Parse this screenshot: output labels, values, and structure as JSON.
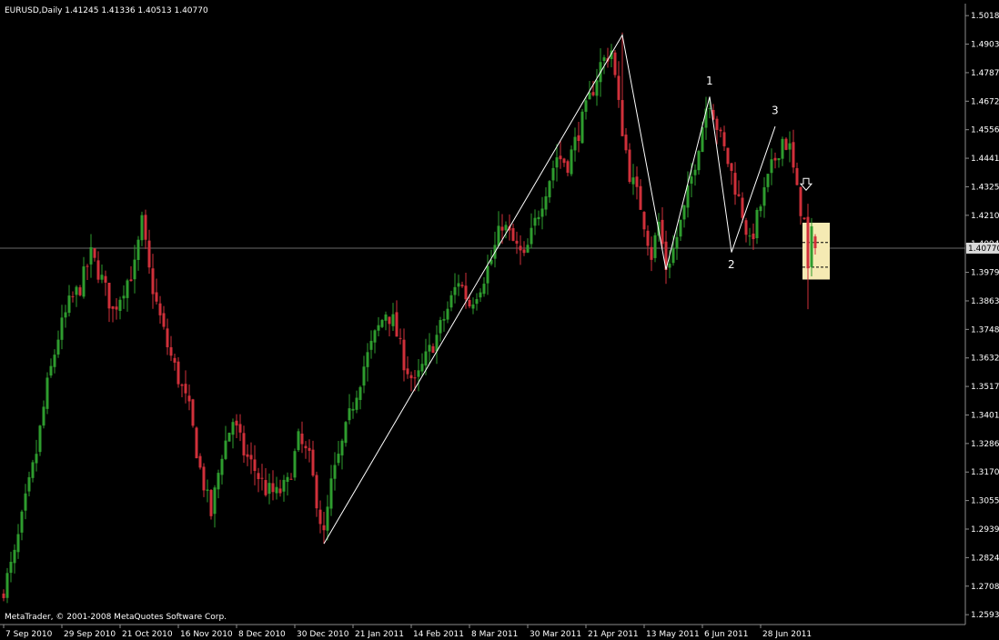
{
  "window": {
    "symbol_header": "EURUSD,Daily  1.41245 1.41336 1.40513 1.40770",
    "copyright": "MetaTrader, © 2001-2008 MetaQuotes Software Corp."
  },
  "colors": {
    "background": "#000000",
    "bull": "#2e9c2e",
    "bear": "#d0303a",
    "axis": "#8c8c8c",
    "zigzag": "#ffffff",
    "highlight_box": "#f5eab3"
  },
  "icons": {
    "signal_arrow": "down-arrow-icon"
  },
  "chart_data": {
    "type": "candlestick",
    "y_range": [
      1.2553,
      1.5067
    ],
    "current_price": "1.40770",
    "y_ticks": [
      "1.50185",
      "1.49030",
      "1.47875",
      "1.46720",
      "1.45565",
      "1.44410",
      "1.43255",
      "1.42100",
      "1.40945",
      "1.39790",
      "1.38635",
      "1.37480",
      "1.36325",
      "1.35170",
      "1.34015",
      "1.32860",
      "1.31705",
      "1.30550",
      "1.29395",
      "1.28240",
      "1.27085",
      "1.25930"
    ],
    "x_ticks": [
      {
        "label": "7 Sep 2010",
        "index": 0
      },
      {
        "label": "29 Sep 2010",
        "index": 16
      },
      {
        "label": "21 Oct 2010",
        "index": 32
      },
      {
        "label": "16 Nov 2010",
        "index": 48
      },
      {
        "label": "8 Dec 2010",
        "index": 64
      },
      {
        "label": "30 Dec 2010",
        "index": 80
      },
      {
        "label": "21 Jan 2011",
        "index": 96
      },
      {
        "label": "14 Feb 2011",
        "index": 112
      },
      {
        "label": "8 Mar 2011",
        "index": 128
      },
      {
        "label": "30 Mar 2011",
        "index": 144
      },
      {
        "label": "21 Apr 2011",
        "index": 160
      },
      {
        "label": "13 May 2011",
        "index": 176
      },
      {
        "label": "6 Jun 2011",
        "index": 192
      },
      {
        "label": "28 Jun 2011",
        "index": 208
      }
    ],
    "close_path": [
      [
        0,
        1.27
      ],
      [
        3,
        1.283
      ],
      [
        6,
        1.305
      ],
      [
        9,
        1.325
      ],
      [
        12,
        1.352
      ],
      [
        15,
        1.372
      ],
      [
        18,
        1.385
      ],
      [
        21,
        1.392
      ],
      [
        24,
        1.405
      ],
      [
        27,
        1.395
      ],
      [
        30,
        1.382
      ],
      [
        33,
        1.392
      ],
      [
        36,
        1.4
      ],
      [
        38,
        1.418
      ],
      [
        40,
        1.398
      ],
      [
        42,
        1.385
      ],
      [
        45,
        1.368
      ],
      [
        48,
        1.355
      ],
      [
        51,
        1.342
      ],
      [
        54,
        1.318
      ],
      [
        57,
        1.3
      ],
      [
        60,
        1.325
      ],
      [
        63,
        1.338
      ],
      [
        66,
        1.325
      ],
      [
        69,
        1.318
      ],
      [
        72,
        1.31
      ],
      [
        75,
        1.308
      ],
      [
        78,
        1.312
      ],
      [
        81,
        1.33
      ],
      [
        84,
        1.322
      ],
      [
        87,
        1.298
      ],
      [
        88,
        1.291
      ],
      [
        90,
        1.312
      ],
      [
        93,
        1.328
      ],
      [
        96,
        1.345
      ],
      [
        99,
        1.36
      ],
      [
        102,
        1.372
      ],
      [
        105,
        1.382
      ],
      [
        107,
        1.378
      ],
      [
        110,
        1.362
      ],
      [
        113,
        1.352
      ],
      [
        116,
        1.363
      ],
      [
        119,
        1.372
      ],
      [
        122,
        1.383
      ],
      [
        125,
        1.395
      ],
      [
        128,
        1.385
      ],
      [
        131,
        1.393
      ],
      [
        134,
        1.403
      ],
      [
        137,
        1.418
      ],
      [
        140,
        1.41
      ],
      [
        143,
        1.403
      ],
      [
        146,
        1.418
      ],
      [
        149,
        1.432
      ],
      [
        152,
        1.445
      ],
      [
        155,
        1.442
      ],
      [
        158,
        1.455
      ],
      [
        161,
        1.468
      ],
      [
        164,
        1.482
      ],
      [
        167,
        1.488
      ],
      [
        169,
        1.465
      ],
      [
        172,
        1.438
      ],
      [
        175,
        1.425
      ],
      [
        178,
        1.405
      ],
      [
        180,
        1.418
      ],
      [
        182,
        1.4
      ],
      [
        184,
        1.407
      ],
      [
        187,
        1.423
      ],
      [
        190,
        1.443
      ],
      [
        193,
        1.465
      ],
      [
        194,
        1.468
      ],
      [
        197,
        1.452
      ],
      [
        200,
        1.438
      ],
      [
        203,
        1.422
      ],
      [
        205,
        1.409
      ],
      [
        208,
        1.425
      ],
      [
        211,
        1.44
      ],
      [
        214,
        1.452
      ],
      [
        216,
        1.448
      ],
      [
        218,
        1.43
      ],
      [
        220,
        1.418
      ],
      [
        221,
        1.398
      ],
      [
        222,
        1.413
      ],
      [
        223,
        1.408
      ]
    ],
    "zigzag": [
      {
        "index": 88,
        "price": 1.288
      },
      {
        "index": 170,
        "price": 1.494
      },
      {
        "index": 182,
        "price": 1.399
      },
      {
        "index": 194,
        "price": 1.469
      },
      {
        "index": 200,
        "price": 1.406
      },
      {
        "index": 212,
        "price": 1.457
      }
    ],
    "swing_labels": [
      {
        "text": "1",
        "index": 194,
        "price": 1.474
      },
      {
        "text": "2",
        "index": 200,
        "price": 1.3995
      },
      {
        "text": "3",
        "index": 212,
        "price": 1.462
      }
    ],
    "highlight_zone": {
      "from_index": 219.5,
      "to_index": 227,
      "top": 1.418,
      "bottom": 1.395,
      "upper_dashed": 1.41,
      "lower_dashed": 1.4
    },
    "signal_arrow": {
      "index": 220,
      "price": 1.433,
      "direction": "down"
    }
  }
}
